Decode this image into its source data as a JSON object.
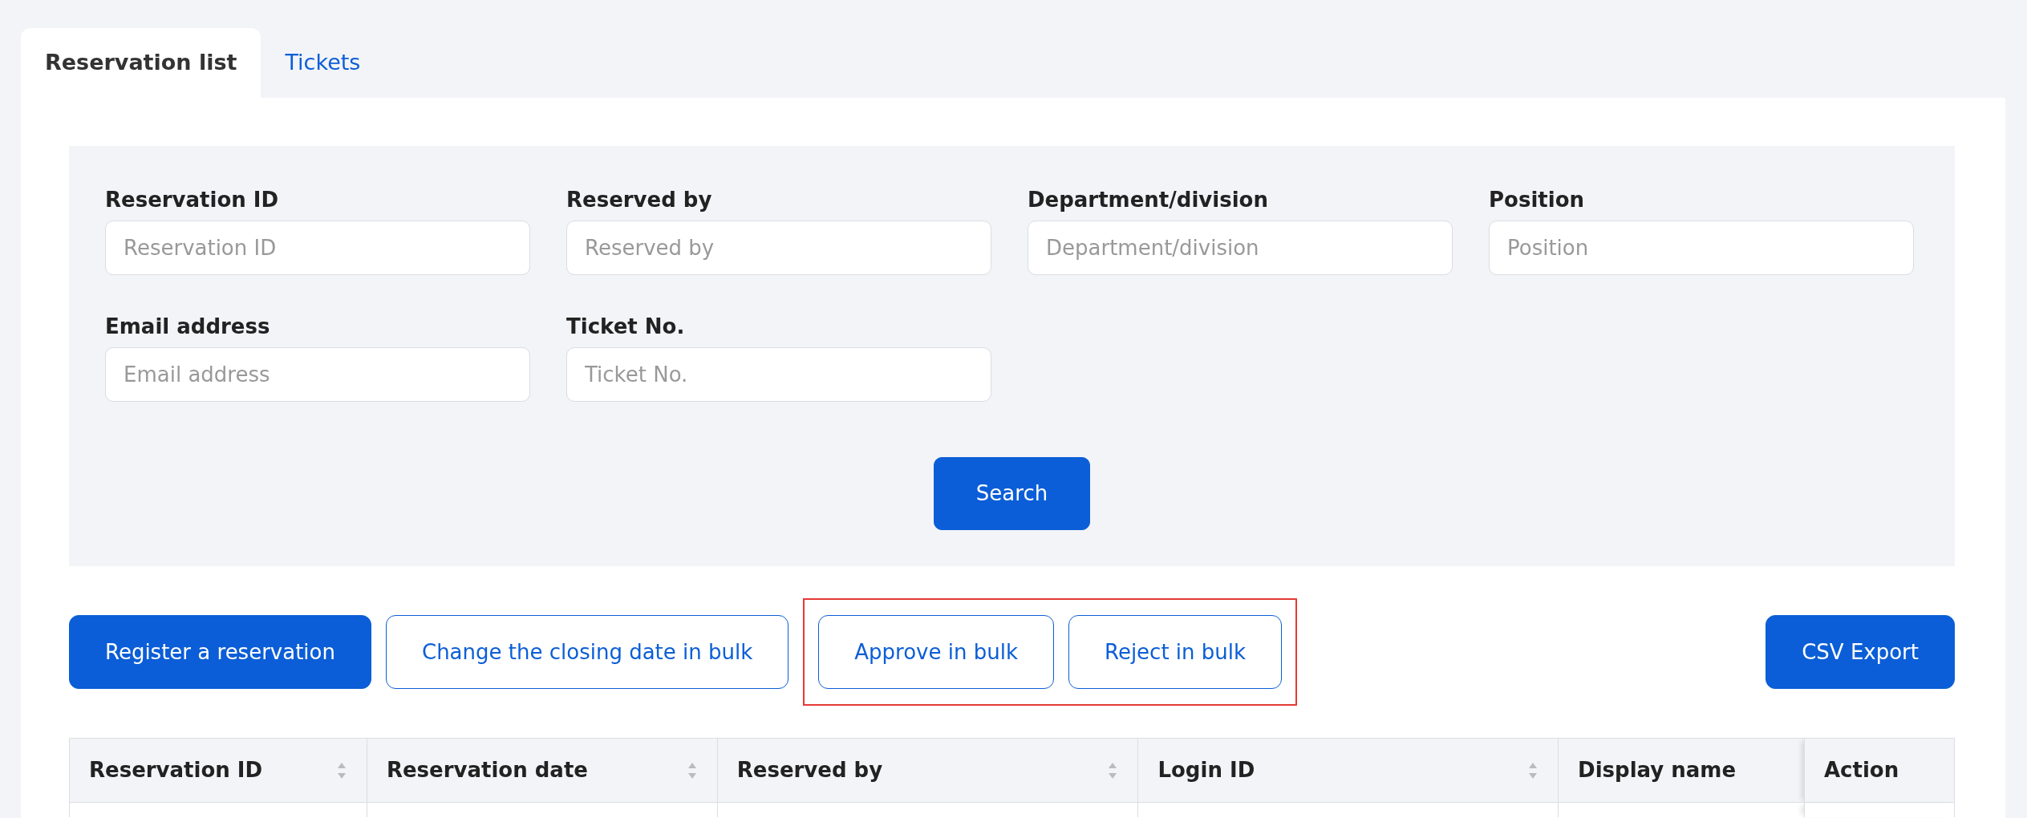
{
  "tabs": [
    {
      "label": "Reservation list",
      "selected": true
    },
    {
      "label": "Tickets",
      "selected": false
    }
  ],
  "search_form": {
    "fields": [
      {
        "label": "Reservation ID",
        "placeholder": "Reservation ID"
      },
      {
        "label": "Reserved by",
        "placeholder": "Reserved by"
      },
      {
        "label": "Department/division",
        "placeholder": "Department/division"
      },
      {
        "label": "Position",
        "placeholder": "Position"
      },
      {
        "label": "Email address",
        "placeholder": "Email address"
      },
      {
        "label": "Ticket No.",
        "placeholder": "Ticket No."
      }
    ],
    "search_button": "Search"
  },
  "actions": [
    {
      "label": "Register a reservation",
      "kind": "primary",
      "highlighted": false
    },
    {
      "label": "Change the closing date in bulk",
      "kind": "outline",
      "highlighted": false
    },
    {
      "label": "Approve in bulk",
      "kind": "outline",
      "highlighted": true
    },
    {
      "label": "Reject in bulk",
      "kind": "outline",
      "highlighted": true
    }
  ],
  "export_button": "CSV Export",
  "table": {
    "columns": [
      {
        "label": "Reservation ID",
        "sortable": true
      },
      {
        "label": "Reservation date",
        "sortable": true
      },
      {
        "label": "Reserved by",
        "sortable": true
      },
      {
        "label": "Login ID",
        "sortable": true
      },
      {
        "label": "Display name",
        "sortable": false
      },
      {
        "label": "Action",
        "sortable": false
      }
    ]
  }
}
